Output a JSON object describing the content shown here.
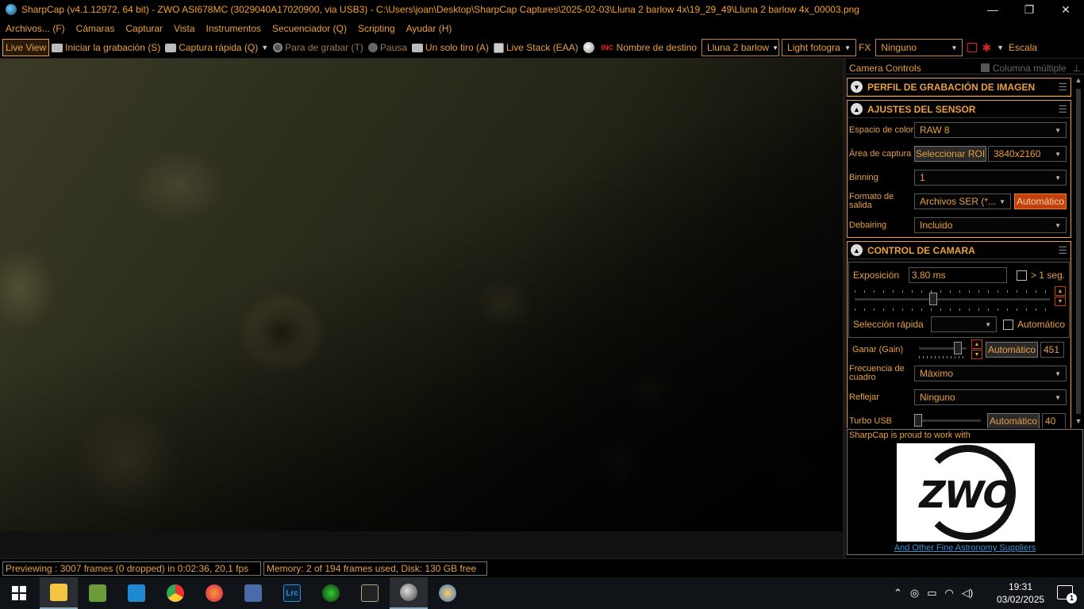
{
  "window": {
    "title": "SharpCap (v4.1.12972, 64 bit) - ZWO ASI678MC (3029040A17020900, via USB3) - C:\\Users\\joan\\Desktop\\SharpCap Captures\\2025-02-03\\Lluna 2 barlow 4x\\19_29_49\\Lluna 2 barlow 4x_00003.png",
    "minimize": "—",
    "maximize": "❐",
    "close": "✕"
  },
  "menu": [
    "Archivos... (F)",
    "Cámaras",
    "Capturar",
    "Vista",
    "Instrumentos",
    "Secuenciador (Q)",
    "Scripting",
    "Ayudar (H)"
  ],
  "toolbar": {
    "live_view": "Live View",
    "start_recording": "Iniciar la grabación (S)",
    "quick_capture": "Captura rápida (Q)",
    "stop_recording": "Para de grabar (T)",
    "pause": "Pausa",
    "single_shot": "Un solo tiro (A)",
    "live_stack": "Live Stack (EAA)",
    "target_name_label": "Nombre de destino",
    "target_name_value": "Lluna 2 barlow",
    "frame_type_value": "Light fotogra",
    "fx_label": "FX",
    "fx_value": "Ninguno",
    "scale_label": "Escala"
  },
  "panel": {
    "title": "Camera Controls",
    "multi_column": "Columna múltiple",
    "groups": {
      "profile": "PERFIL DE GRABACIÓN DE IMAGEN",
      "sensor": "AJUSTES DEL SENSOR",
      "camera": "CONTROL DE CAMARA"
    },
    "sensor": {
      "color_space_label": "Espacio de color",
      "color_space_value": "RAW 8",
      "capture_area_label": "Área de captura",
      "select_roi": "Seleccionar ROI",
      "capture_area_value": "3840x2160",
      "binning_label": "Binning",
      "binning_value": "1",
      "output_format_label": "Formato de salida",
      "output_format_value": "Archivos SER (*...",
      "output_format_auto": "Automático",
      "debayer_label": "Debairing",
      "debayer_value": "Incluido"
    },
    "camera": {
      "exposure_label": "Exposición",
      "exposure_value": "3,80 ms",
      "over_1s": "> 1 seg.",
      "quick_select_label": "Selección rápida",
      "quick_select_auto": "Automático",
      "gain_label": "Ganar (Gain)",
      "gain_auto": "Automático",
      "gain_value": "451",
      "frame_rate_label": "Frecuencia de cuadro",
      "frame_rate_value": "Máximo",
      "flip_label": "Reflejar",
      "flip_value": "Ninguno",
      "turbo_label": "Turbo USB",
      "turbo_auto": "Automático",
      "turbo_value": "40"
    },
    "ad": {
      "proud": "SharpCap is proud to work with",
      "logo_text": "ZWO",
      "link": "And Other Fine Astronomy Suppliers"
    }
  },
  "status": {
    "previewing": "Previewing : 3007 frames (0 dropped) in 0:02:36, 20,1 fps",
    "memory": "Memory: 2 of 194 frames used, Disk: 130 GB free"
  },
  "taskbar": {
    "time": "19:31",
    "date": "03/02/2025",
    "notifications": "1",
    "apps": [
      "windows-start",
      "file-explorer",
      "notepad",
      "vscode",
      "chrome",
      "firefox",
      "network-app",
      "lightroom-classic",
      "media-app",
      "sharpcap-app",
      "planet-app",
      "paint-app"
    ]
  },
  "colors": {
    "accent": "#e8a040",
    "hot_button": "#c04010",
    "link": "#3a8fd0"
  }
}
